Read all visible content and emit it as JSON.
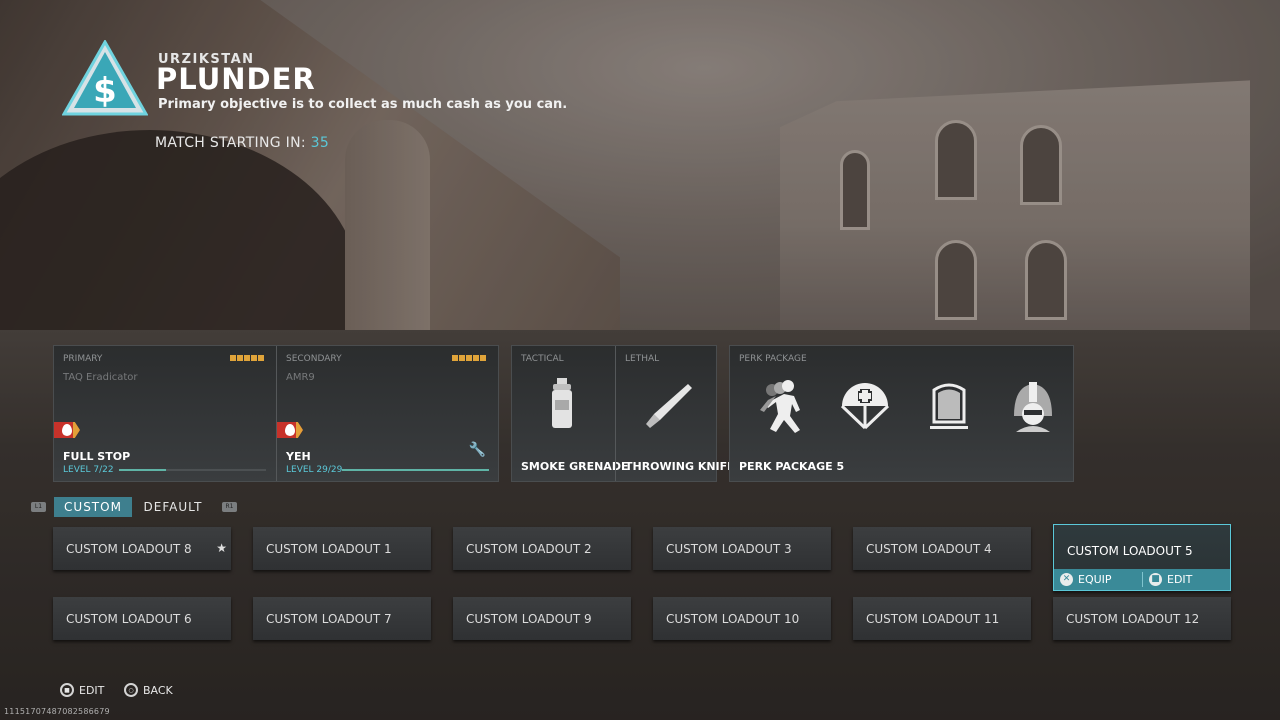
{
  "header": {
    "map_name": "URZIKSTAN",
    "mode_title": "PLUNDER",
    "mode_description": "Primary objective is to collect as much cash as you can.",
    "match_label": "MATCH STARTING IN:",
    "match_countdown": "35"
  },
  "loadout": {
    "primary": {
      "slot_label": "PRIMARY",
      "weapon": "TAQ Eradicator",
      "blueprint": "FULL STOP",
      "level_text": "LEVEL 7/22",
      "level_progress": 0.32
    },
    "secondary": {
      "slot_label": "SECONDARY",
      "weapon": "AMR9",
      "blueprint": "YEH",
      "level_text": "LEVEL 29/29",
      "level_progress": 1.0
    },
    "tactical": {
      "slot_label": "TACTICAL",
      "item": "SMOKE GRENADE",
      "icon": "smoke-grenade-icon"
    },
    "lethal": {
      "slot_label": "LETHAL",
      "item": "THROWING KNIFE",
      "icon": "throwing-knife-icon"
    },
    "perks": {
      "slot_label": "PERK PACKAGE",
      "name": "PERK PACKAGE 5",
      "icons": [
        "double-time-icon",
        "scavenger-medic-icon",
        "armor-plate-icon",
        "helmet-icon"
      ]
    }
  },
  "tabs": {
    "left_bumper": "L1",
    "right_bumper": "R1",
    "custom": "CUSTOM",
    "default": "DEFAULT"
  },
  "loadouts": {
    "row1": [
      "CUSTOM LOADOUT 8",
      "CUSTOM LOADOUT 1",
      "CUSTOM LOADOUT 2",
      "CUSTOM LOADOUT 3",
      "CUSTOM LOADOUT 4",
      "CUSTOM LOADOUT 5"
    ],
    "row2": [
      "CUSTOM LOADOUT 6",
      "CUSTOM LOADOUT 7",
      "CUSTOM LOADOUT 9",
      "CUSTOM LOADOUT 10",
      "CUSTOM LOADOUT 11",
      "CUSTOM LOADOUT 12"
    ],
    "selected_actions": {
      "equip": "EQUIP",
      "edit": "EDIT"
    }
  },
  "footer": {
    "edit": "EDIT",
    "back": "BACK",
    "version": "11151707487082586679"
  },
  "colors": {
    "accent": "#5bc8d8",
    "tab_active": "#3e7f8e",
    "rating": "#e0a43a"
  }
}
